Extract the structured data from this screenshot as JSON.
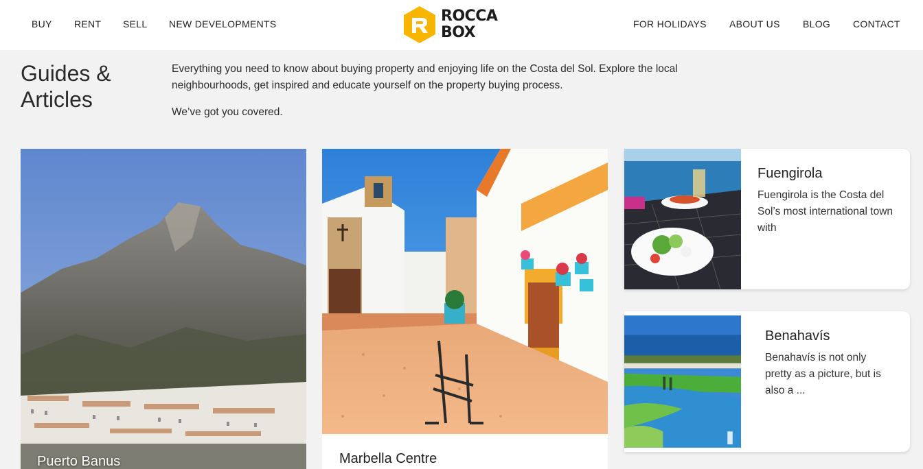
{
  "nav": {
    "left": [
      "BUY",
      "RENT",
      "SELL",
      "NEW DEVELOPMENTS"
    ],
    "right": [
      "FOR HOLIDAYS",
      "ABOUT US",
      "BLOG",
      "CONTACT"
    ]
  },
  "logo": {
    "line1": "ROCCA",
    "line2": "BOX",
    "color": "#f7b500"
  },
  "page": {
    "title": "Guides & Articles",
    "intro": "Everything you need to know about buying property and enjoying life on the Costa del Sol. Explore the local neighbourhoods, get inspired and educate yourself on the property buying process.",
    "tagline": "We’ve got you covered."
  },
  "articles": [
    {
      "title": "Puerto Banus",
      "image": "mountain-village-photo"
    },
    {
      "title": "Marbella Centre",
      "image": "white-village-square-photo"
    },
    {
      "title": "Fuengirola",
      "excerpt": "Fuengirola is the Costa del Sol’s most international town with",
      "image": "seaside-dinner-photo"
    },
    {
      "title": "Benahavís",
      "excerpt": "Benahavís is not only pretty as a picture, but is also a ...",
      "image": "golf-course-lake-photo"
    }
  ]
}
